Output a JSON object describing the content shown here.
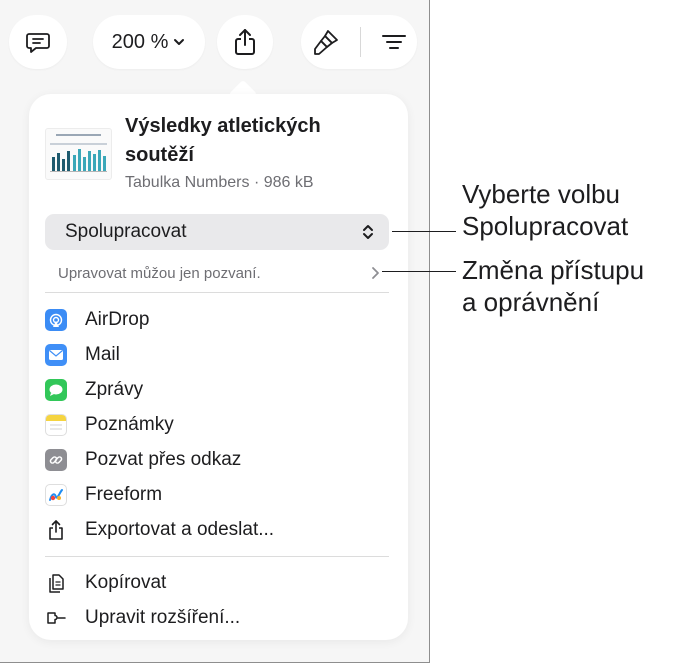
{
  "toolbar": {
    "zoom_label": "200 %"
  },
  "share_popover": {
    "doc_title": "Výsledky atletických soutěží",
    "doc_meta": "Tabulka Numbers · 986 kB",
    "collaboration_select": "Spolupracovat",
    "permissions_text": "Upravovat můžou jen pozvaní.",
    "share_targets": [
      {
        "label": "AirDrop",
        "icon": "airdrop-icon",
        "color": "#3b8cf5"
      },
      {
        "label": "Mail",
        "icon": "mail-icon",
        "color": "#3f8ff7"
      },
      {
        "label": "Zprávy",
        "icon": "messages-icon",
        "color": "#32c759"
      },
      {
        "label": "Poznámky",
        "icon": "notes-icon",
        "color": "#f5d440"
      },
      {
        "label": "Pozvat přes odkaz",
        "icon": "link-icon",
        "color": "#8e8e93"
      },
      {
        "label": "Freeform",
        "icon": "freeform-icon",
        "color": "#ffffff"
      },
      {
        "label": "Exportovat a odeslat...",
        "icon": "export-icon",
        "color": "#1d1d1f"
      }
    ],
    "actions": [
      {
        "label": "Kopírovat",
        "icon": "copy-icon"
      },
      {
        "label": "Upravit rozšíření...",
        "icon": "extensions-icon"
      }
    ]
  },
  "callouts": {
    "collaborate": [
      "Vyberte volbu",
      "Spolupracovat"
    ],
    "access": [
      "Změna přístupu",
      "a oprávnění"
    ]
  }
}
